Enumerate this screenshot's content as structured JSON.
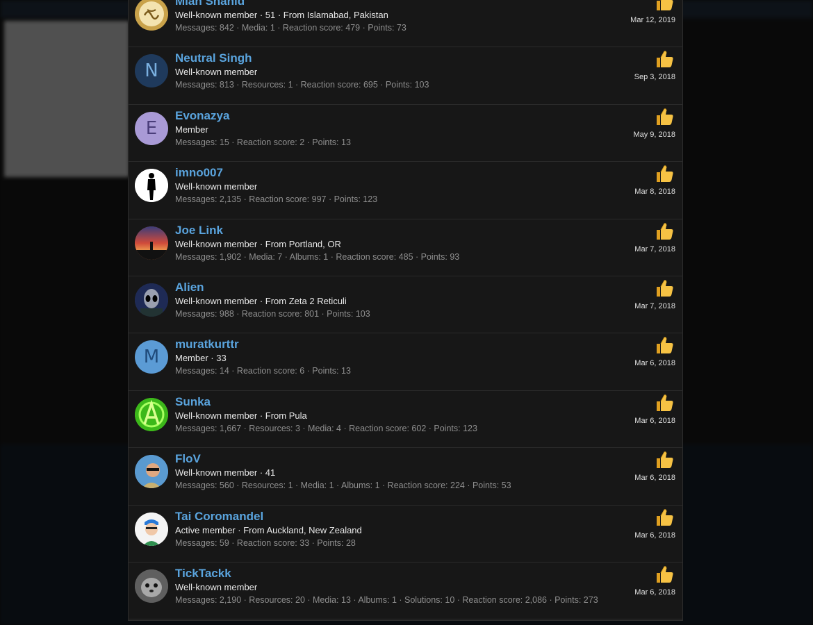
{
  "reactions": [
    {
      "name": "Mian Shahid",
      "info": "Well-known member · 51 · From Islamabad, Pakistan",
      "stats": "Messages: 842 · Media: 1 · Reaction score: 479 · Points: 73",
      "date": "Mar 12, 2019",
      "avatar": {
        "kind": "image",
        "icon": "calligraphy-emblem-icon",
        "color": "#c9a24a"
      }
    },
    {
      "name": "Neutral Singh",
      "info": "Well-known member",
      "stats": "Messages: 813 · Resources: 1 · Reaction score: 695 · Points: 103",
      "date": "Sep 3, 2018",
      "avatar": {
        "kind": "letter",
        "letter": "N",
        "color": "#1f3a5c",
        "text_color": "#7ab0e0"
      }
    },
    {
      "name": "Evonazya",
      "info": "Member",
      "stats": "Messages: 15 · Reaction score: 2 · Points: 13",
      "date": "May 9, 2018",
      "avatar": {
        "kind": "letter",
        "letter": "E",
        "color": "#a99ad6",
        "text_color": "#4a3d7a"
      }
    },
    {
      "name": "imno007",
      "info": "Well-known member",
      "stats": "Messages: 2,135 · Reaction score: 997 · Points: 123",
      "date": "Mar 8, 2018",
      "avatar": {
        "kind": "image",
        "icon": "silhouette-icon",
        "color": "#ffffff"
      }
    },
    {
      "name": "Joe Link",
      "info": "Well-known member · From Portland, OR",
      "stats": "Messages: 1,902 · Media: 7 · Albums: 1 · Reaction score: 485 · Points: 93",
      "date": "Mar 7, 2018",
      "avatar": {
        "kind": "image",
        "icon": "sunset-photo-icon",
        "color": "#a8483a"
      }
    },
    {
      "name": "Alien",
      "info": "Well-known member · From Zeta 2 Reticuli",
      "stats": "Messages: 988 · Reaction score: 801 · Points: 103",
      "date": "Mar 7, 2018",
      "avatar": {
        "kind": "image",
        "icon": "alien-icon",
        "color": "#2a3a6a"
      }
    },
    {
      "name": "muratkurttr",
      "info": "Member · 33",
      "stats": "Messages: 14 · Reaction score: 6 · Points: 13",
      "date": "Mar 6, 2018",
      "avatar": {
        "kind": "letter",
        "letter": "M",
        "color": "#5b9bd5",
        "text_color": "#1f4a7a"
      }
    },
    {
      "name": "Sunka",
      "info": "Well-known member · From Pula",
      "stats": "Messages: 1,667 · Resources: 3 · Media: 4 · Reaction score: 602 · Points: 123",
      "date": "Mar 6, 2018",
      "avatar": {
        "kind": "image",
        "icon": "green-anarchy-icon",
        "color": "#4fcf1f"
      }
    },
    {
      "name": "FloV",
      "info": "Well-known member · 41",
      "stats": "Messages: 560 · Resources: 1 · Media: 1 · Albums: 1 · Reaction score: 224 · Points: 53",
      "date": "Mar 6, 2018",
      "avatar": {
        "kind": "image",
        "icon": "person-photo-icon",
        "color": "#5a9ad0"
      }
    },
    {
      "name": "Tai Coromandel",
      "info": "Active member · From Auckland, New Zealand",
      "stats": "Messages: 59 · Reaction score: 33 · Points: 28",
      "date": "Mar 6, 2018",
      "avatar": {
        "kind": "image",
        "icon": "cartoon-person-icon",
        "color": "#f2f2f2"
      }
    },
    {
      "name": "TickTackk",
      "info": "Well-known member",
      "stats": "Messages: 2,190 · Resources: 20 · Media: 13 · Albums: 1 · Solutions: 10 · Reaction score: 2,086 · Points: 273",
      "date": "Mar 6, 2018",
      "avatar": {
        "kind": "image",
        "icon": "seal-photo-icon",
        "color": "#6a6a6a"
      }
    }
  ],
  "reaction_icon": "thumbs-up-icon",
  "colors": {
    "username": "#5aa4de",
    "panel_bg": "#171717",
    "thumb": "#f6c244"
  }
}
